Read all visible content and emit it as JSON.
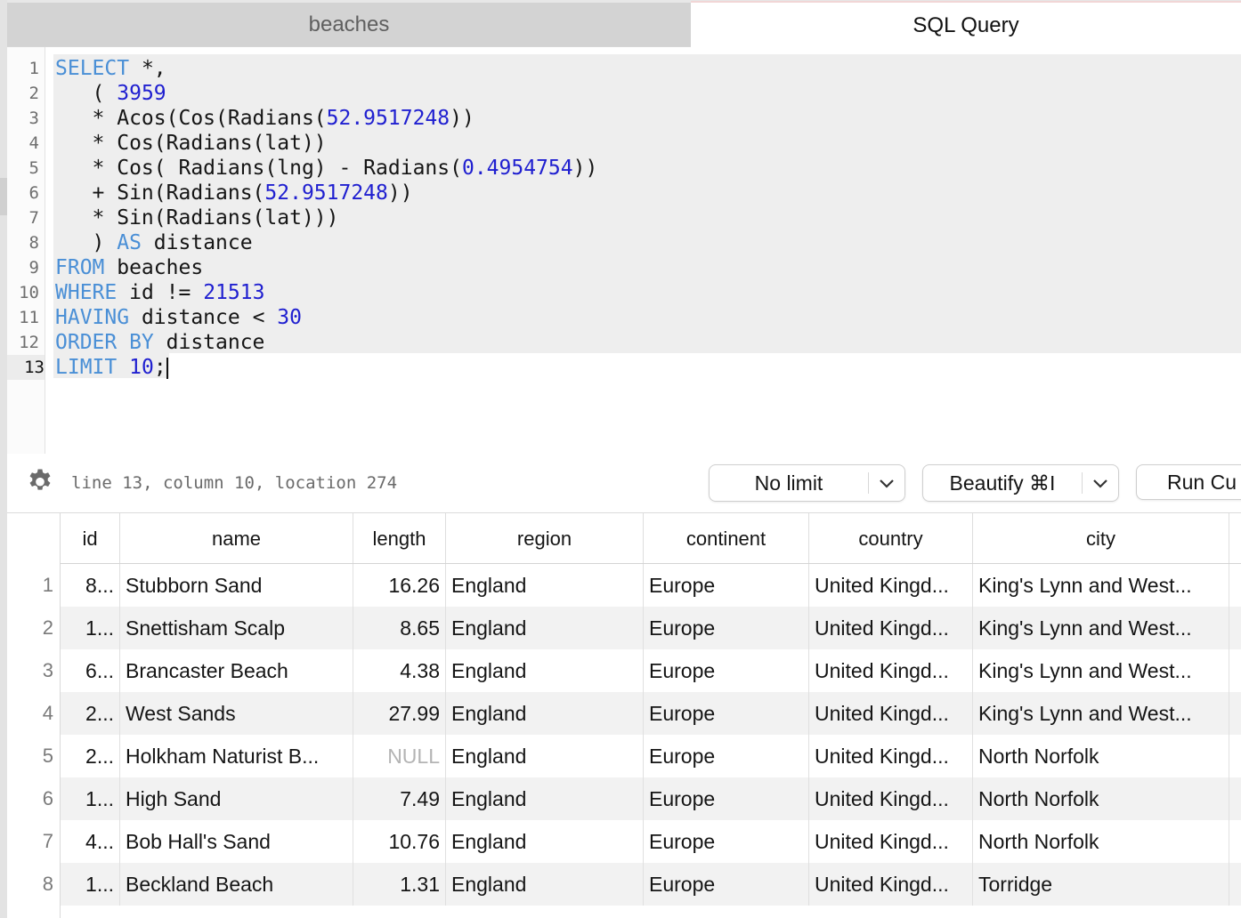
{
  "tabs": [
    {
      "label": "beaches",
      "active": false
    },
    {
      "label": "SQL Query",
      "active": true
    }
  ],
  "editor": {
    "line_numbers": [
      "1",
      "2",
      "3",
      "4",
      "5",
      "6",
      "7",
      "8",
      "9",
      "10",
      "11",
      "12",
      "13"
    ],
    "current_line": "13",
    "lines": [
      [
        {
          "t": "kw",
          "v": "SELECT"
        },
        {
          "t": "p",
          "v": " *,"
        }
      ],
      [
        {
          "t": "p",
          "v": "   ( "
        },
        {
          "t": "num",
          "v": "3959"
        }
      ],
      [
        {
          "t": "p",
          "v": "   * Acos(Cos(Radians("
        },
        {
          "t": "num",
          "v": "52.9517248"
        },
        {
          "t": "p",
          "v": "))"
        }
      ],
      [
        {
          "t": "p",
          "v": "   * Cos(Radians(lat))"
        }
      ],
      [
        {
          "t": "p",
          "v": "   * Cos( Radians(lng) - Radians("
        },
        {
          "t": "num",
          "v": "0.4954754"
        },
        {
          "t": "p",
          "v": "))"
        }
      ],
      [
        {
          "t": "p",
          "v": "   + Sin(Radians("
        },
        {
          "t": "num",
          "v": "52.9517248"
        },
        {
          "t": "p",
          "v": "))"
        }
      ],
      [
        {
          "t": "p",
          "v": "   * Sin(Radians(lat)))"
        }
      ],
      [
        {
          "t": "p",
          "v": "   ) "
        },
        {
          "t": "kw",
          "v": "AS"
        },
        {
          "t": "p",
          "v": " distance"
        }
      ],
      [
        {
          "t": "kw",
          "v": "FROM"
        },
        {
          "t": "p",
          "v": " beaches"
        }
      ],
      [
        {
          "t": "kw",
          "v": "WHERE"
        },
        {
          "t": "p",
          "v": " id != "
        },
        {
          "t": "num",
          "v": "21513"
        }
      ],
      [
        {
          "t": "kw",
          "v": "HAVING"
        },
        {
          "t": "p",
          "v": " distance < "
        },
        {
          "t": "num",
          "v": "30"
        }
      ],
      [
        {
          "t": "kw",
          "v": "ORDER BY"
        },
        {
          "t": "p",
          "v": " distance"
        }
      ],
      [
        {
          "t": "kw",
          "v": "LIMIT"
        },
        {
          "t": "p",
          "v": " "
        },
        {
          "t": "num",
          "v": "10"
        },
        {
          "t": "p",
          "v": ";"
        }
      ]
    ]
  },
  "status": {
    "text": "line 13, column 10, location 274",
    "limit_label": "No limit",
    "beautify_label": "Beautify ⌘I",
    "run_label": "Run Cu"
  },
  "colors": {
    "keyword": "#4a8fd6",
    "number": "#2020d0",
    "tab_inactive_bg": "#d3d3d3",
    "row_alt_bg": "#f2f2f2",
    "null_text": "#b4b4b4"
  },
  "icons": {
    "settings": "gear-icon",
    "dropdown": "chevron-down-icon"
  },
  "results": {
    "columns": [
      "id",
      "name",
      "length",
      "region",
      "continent",
      "country",
      "city"
    ],
    "rows": [
      {
        "n": "1",
        "id": "8...",
        "name": "Stubborn Sand",
        "length": "16.26",
        "region": "England",
        "continent": "Europe",
        "country": "United Kingd...",
        "city": "King's Lynn and West..."
      },
      {
        "n": "2",
        "id": "1...",
        "name": "Snettisham Scalp",
        "length": "8.65",
        "region": "England",
        "continent": "Europe",
        "country": "United Kingd...",
        "city": "King's Lynn and West..."
      },
      {
        "n": "3",
        "id": "6...",
        "name": "Brancaster Beach",
        "length": "4.38",
        "region": "England",
        "continent": "Europe",
        "country": "United Kingd...",
        "city": "King's Lynn and West..."
      },
      {
        "n": "4",
        "id": "2...",
        "name": "West Sands",
        "length": "27.99",
        "region": "England",
        "continent": "Europe",
        "country": "United Kingd...",
        "city": "King's Lynn and West..."
      },
      {
        "n": "5",
        "id": "2...",
        "name": "Holkham Naturist B...",
        "length": "NULL",
        "region": "England",
        "continent": "Europe",
        "country": "United Kingd...",
        "city": "North Norfolk"
      },
      {
        "n": "6",
        "id": "1...",
        "name": "High Sand",
        "length": "7.49",
        "region": "England",
        "continent": "Europe",
        "country": "United Kingd...",
        "city": "North Norfolk"
      },
      {
        "n": "7",
        "id": "4...",
        "name": "Bob Hall's Sand",
        "length": "10.76",
        "region": "England",
        "continent": "Europe",
        "country": "United Kingd...",
        "city": "North Norfolk"
      },
      {
        "n": "8",
        "id": "1...",
        "name": "Beckland Beach",
        "length": "1.31",
        "region": "England",
        "continent": "Europe",
        "country": "United Kingd...",
        "city": "Torridge"
      }
    ]
  }
}
